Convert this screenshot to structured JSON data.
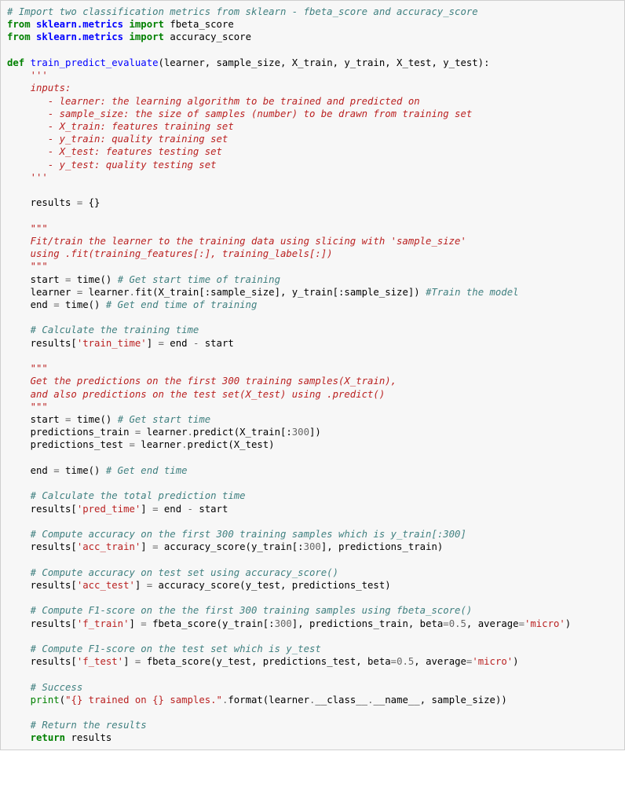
{
  "code": {
    "t01": "# Import two classification metrics from sklearn - fbeta_score and accuracy_score",
    "t02": "from",
    "t03": "sklearn.metrics",
    "t04": "import",
    "t05": "fbeta_score",
    "t06": "accuracy_score",
    "t07": "def",
    "t08": "train_predict_evaluate",
    "t09": "(learner, sample_size, X_train, y_train, X_test, y_test):",
    "t10": "    '''",
    "t11": "    inputs:",
    "t12": "       - learner: the learning algorithm to be trained and predicted on",
    "t13": "       - sample_size: the size of samples (number) to be drawn from training set",
    "t14": "       - X_train: features training set",
    "t15": "       - y_train: quality training set",
    "t16": "       - X_test: features testing set",
    "t17": "       - y_test: quality testing set",
    "t18": "    '''",
    "t19": "    results ",
    "t19b": "=",
    "t19c": " {}",
    "t20": "    \"\"\"",
    "t21": "    Fit/train the learner to the training data using slicing with 'sample_size'",
    "t22": "    using .fit(training_features[:], training_labels[:])",
    "t23": "    \"\"\"",
    "t24": "    start ",
    "t24b": "=",
    "t24c": " time() ",
    "t24d": "# Get start time of training",
    "t25a": "    learner ",
    "t25b": "=",
    "t25c": " learner",
    "t25d": ".",
    "t25e": "fit(X_train[:sample_size], y_train[:sample_size]) ",
    "t25f": "#Train the model",
    "t26a": "    end ",
    "t26b": "=",
    "t26c": " time() ",
    "t26d": "# Get end time of training",
    "t27": "    # Calculate the training time",
    "t28a": "    results[",
    "t28b": "'train_time'",
    "t28c": "] ",
    "t28d": "=",
    "t28e": " end ",
    "t28f": "-",
    "t28g": " start",
    "t29": "    \"\"\"",
    "t30": "    Get the predictions on the first 300 training samples(X_train),",
    "t31": "    and also predictions on the test set(X_test) using .predict()",
    "t32": "    \"\"\"",
    "t33a": "    start ",
    "t33b": "=",
    "t33c": " time() ",
    "t33d": "# Get start time",
    "t34a": "    predictions_train ",
    "t34b": "=",
    "t34c": " learner",
    "t34d": ".",
    "t34e": "predict(X_train[:",
    "t34f": "300",
    "t34g": "])",
    "t35a": "    predictions_test ",
    "t35b": "=",
    "t35c": " learner",
    "t35d": ".",
    "t35e": "predict(X_test)",
    "t36a": "    end ",
    "t36b": "=",
    "t36c": " time() ",
    "t36d": "# Get end time",
    "t37": "    # Calculate the total prediction time",
    "t38a": "    results[",
    "t38b": "'pred_time'",
    "t38c": "] ",
    "t38d": "=",
    "t38e": " end ",
    "t38f": "-",
    "t38g": " start",
    "t39": "    # Compute accuracy on the first 300 training samples which is y_train[:300]",
    "t40a": "    results[",
    "t40b": "'acc_train'",
    "t40c": "] ",
    "t40d": "=",
    "t40e": " accuracy_score(y_train[:",
    "t40f": "300",
    "t40g": "], predictions_train)",
    "t41": "    # Compute accuracy on test set using accuracy_score()",
    "t42a": "    results[",
    "t42b": "'acc_test'",
    "t42c": "] ",
    "t42d": "=",
    "t42e": " accuracy_score(y_test, predictions_test)",
    "t43": "    # Compute F1-score on the the first 300 training samples using fbeta_score()",
    "t44a": "    results[",
    "t44b": "'f_train'",
    "t44c": "] ",
    "t44d": "=",
    "t44e": " fbeta_score(y_train[:",
    "t44f": "300",
    "t44g": "], predictions_train, beta",
    "t44h": "=",
    "t44i": "0.5",
    "t44j": ", average",
    "t44k": "=",
    "t44l": "'micro'",
    "t44m": ")",
    "t45": "    # Compute F1-score on the test set which is y_test",
    "t46a": "    results[",
    "t46b": "'f_test'",
    "t46c": "] ",
    "t46d": "=",
    "t46e": " fbeta_score(y_test, predictions_test, beta",
    "t46f": "=",
    "t46g": "0.5",
    "t46h": ", average",
    "t46i": "=",
    "t46j": "'micro'",
    "t46k": ")",
    "t47": "    # Success",
    "t48a": "    ",
    "t48b": "print",
    "t48c": "(",
    "t48d": "\"{} trained on {} samples.\"",
    "t48e": ".",
    "t48f": "format(learner",
    "t48g": ".",
    "t48h": "__class__",
    "t48i": ".",
    "t48j": "__name__, sample_size))",
    "t49": "    # Return the results",
    "t50a": "    ",
    "t50b": "return",
    "t50c": " results"
  }
}
